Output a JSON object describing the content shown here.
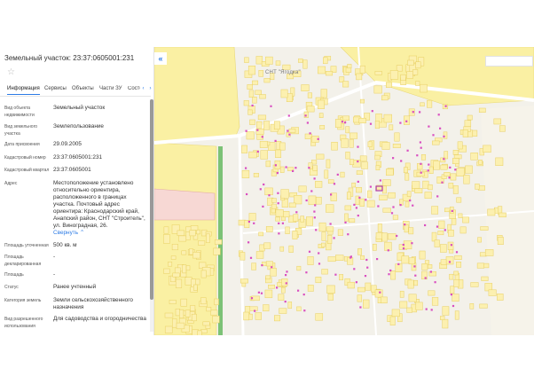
{
  "panel": {
    "title": "Земельный участок: 23:37:0605001:231",
    "star_icon": "star-icon",
    "tabs": [
      {
        "label": "Информация"
      },
      {
        "label": "Сервисы"
      },
      {
        "label": "Объекты"
      },
      {
        "label": "Части ЗУ"
      },
      {
        "label": "Состоя"
      }
    ],
    "tab_left_arrow": "‹",
    "tab_right_arrow": "›",
    "rows": [
      {
        "label": "Вид объекта недвижимости",
        "value": "Земельный участок"
      },
      {
        "label": "Вид земельного участка",
        "value": "Землепользование"
      },
      {
        "label": "Дата присвоения",
        "value": "29.09.2005"
      },
      {
        "label": "Кадастровый номер",
        "value": "23:37:0605001:231"
      },
      {
        "label": "Кадастровый квартал",
        "value": "23:37:0605001"
      },
      {
        "label": "Адрес",
        "value": "Местоположение установлено относительно ориентира, расположенного в границах участка. Почтовый адрес ориентира: Краснодарский край, Анапский район, СНТ \"Строитель\", ул. Виноградная, 26."
      },
      {
        "label": "Площадь уточненная",
        "value": "500 кв. м"
      },
      {
        "label": "Площадь декларированная",
        "value": "-"
      },
      {
        "label": "Площадь",
        "value": "-"
      },
      {
        "label": "Статус",
        "value": "Ранее учтенный"
      },
      {
        "label": "Категория земель",
        "value": "Земли сельскохозяйственного назначения"
      },
      {
        "label": "Вид разрешенного использования",
        "value": "Для садоводства и огородничества"
      }
    ],
    "address_toggle": "Свернуть",
    "address_toggle_icon": "chevron-up-icon"
  },
  "map": {
    "collapse_icon": "double-chevron-left-icon",
    "collapse_glyph": "«",
    "settlement_label": "СНТ \"Ягодка\"",
    "colors": {
      "background": "#f3f1ea",
      "field": "#faf0a3",
      "plot_fill": "#fcf0b0",
      "plot_stroke": "#e8cf63",
      "building": "#d94fc0",
      "road": "#ffffff",
      "green_strip": "#7cc276",
      "pink_zone": "#f7d8d4",
      "selection": "#b13aa8"
    }
  }
}
